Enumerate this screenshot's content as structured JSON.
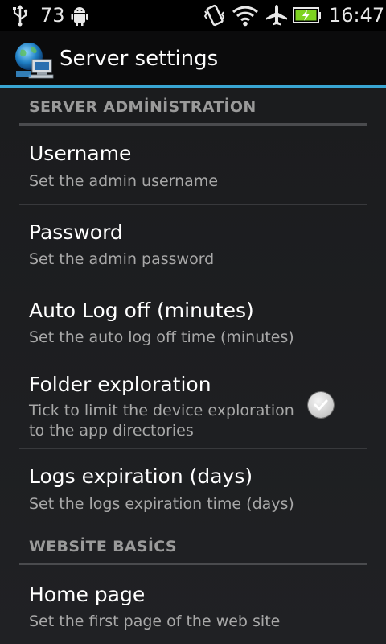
{
  "status_bar": {
    "battery_level": "73",
    "time": "16:47",
    "icons": [
      "usb-icon",
      "android-debug-icon",
      "vibrate-icon",
      "wifi-icon",
      "airplane-mode-icon",
      "battery-charging-icon"
    ]
  },
  "action_bar": {
    "title": "Server settings",
    "logo_icon": "server-globe-icon",
    "accent_color": "#39a6d3"
  },
  "sections": [
    {
      "header": "SERVER ADMİNİSTRATİON",
      "items": [
        {
          "title": "Username",
          "summary": "Set the admin username"
        },
        {
          "title": "Password",
          "summary": "Set the admin password"
        },
        {
          "title": "Auto Log off (minutes)",
          "summary": "Set the auto log off time (minutes)"
        },
        {
          "title": "Folder exploration",
          "summary": "Tick to limit the device exploration to the app directories",
          "checked": true
        },
        {
          "title": "Logs expiration (days)",
          "summary": "Set the logs expiration time (days)"
        }
      ]
    },
    {
      "header": "WEBSİTE BASİCS",
      "items": [
        {
          "title": "Home page",
          "summary": "Set the first page of the web site"
        }
      ]
    }
  ]
}
